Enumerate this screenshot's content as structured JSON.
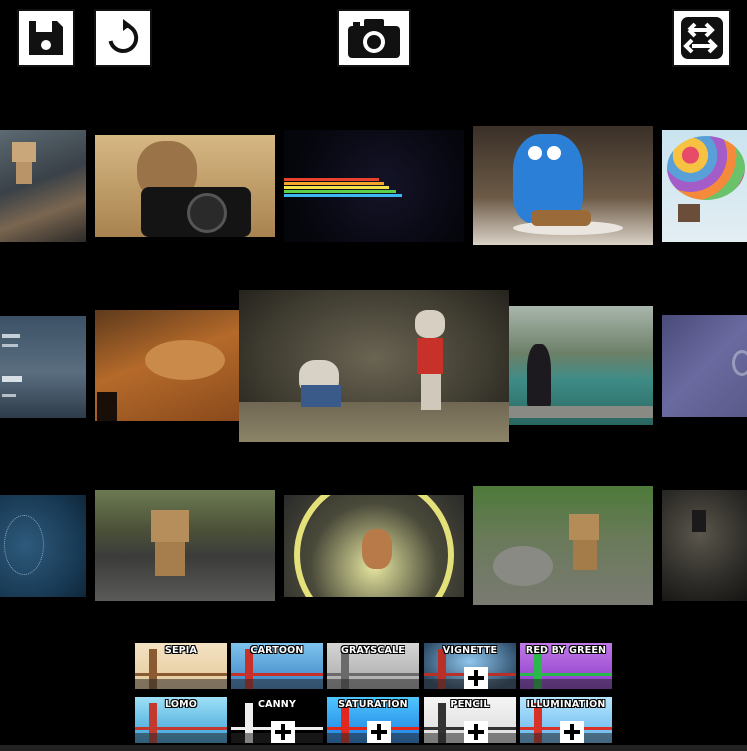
{
  "toolbar": {
    "save_icon": "floppy-disk-icon",
    "reset_icon": "rotate-icon",
    "camera_icon": "camera-icon",
    "swap_icon": "swap-arrows-icon"
  },
  "gallery": {
    "rows": [
      [
        "danbo-on-tiles",
        "kitten-with-nikon-camera",
        "rainbow-streaks",
        "cookie-monster-with-cookies",
        "balloon-house"
      ],
      [
        "text-poster-blue",
        "kitten-asleep-on-guitar",
        "cats-fighting",
        "person-at-lake",
        "purple-abstract"
      ],
      [
        "blue-network-pattern",
        "danbo-in-rain",
        "kitten-in-wheel",
        "danbo-on-rocks",
        "dark-wall"
      ]
    ]
  },
  "filters": [
    {
      "label": "SEPIA",
      "plus": false
    },
    {
      "label": "CARTOON",
      "plus": false
    },
    {
      "label": "GRAYSCALE",
      "plus": false
    },
    {
      "label": "VIGNETTE",
      "plus": true
    },
    {
      "label": "RED BY GREEN",
      "plus": false
    },
    {
      "label": "LOMO",
      "plus": false
    },
    {
      "label": "CANNY",
      "plus": true
    },
    {
      "label": "SATURATION",
      "plus": true
    },
    {
      "label": "PENCIL",
      "plus": true
    },
    {
      "label": "ILLUMINATION",
      "plus": true
    }
  ]
}
